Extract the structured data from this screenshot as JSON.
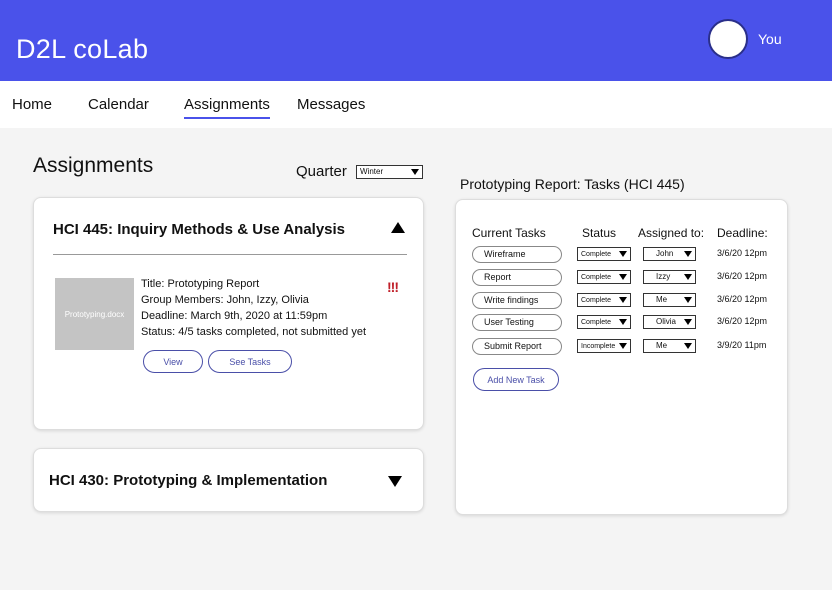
{
  "app": {
    "title": "D2L coLab",
    "user_name": "You"
  },
  "nav": {
    "home": "Home",
    "calendar": "Calendar",
    "assignments": "Assignments",
    "messages": "Messages"
  },
  "main": {
    "title": "Assignments",
    "quarter_label": "Quarter",
    "quarter_value": "Winter"
  },
  "courses": [
    {
      "title": "HCI 445: Inquiry Methods & Use Analysis",
      "expanded": true,
      "assignment": {
        "file_name": "Prototyping.docx",
        "title": "Title: Prototyping Report",
        "members": "Group Members: John, Izzy, Olivia",
        "deadline": "Deadline: March 9th, 2020 at 11:59pm",
        "status": "Status: 4/5 tasks completed, not submitted yet",
        "priority": "!!!",
        "view_label": "View",
        "see_tasks_label": "See Tasks"
      }
    },
    {
      "title": "HCI 430: Prototyping & Implementation",
      "expanded": false
    }
  ],
  "tasks_panel": {
    "heading": "Prototyping Report: Tasks (HCI 445)",
    "columns": {
      "task": "Current Tasks",
      "status": "Status",
      "assigned": "Assigned to:",
      "deadline": "Deadline:"
    },
    "tasks": [
      {
        "name": "Wireframe",
        "status": "Complete",
        "assignee": "John",
        "deadline": "3/6/20 12pm"
      },
      {
        "name": "Report",
        "status": "Complete",
        "assignee": "Izzy",
        "deadline": "3/6/20 12pm"
      },
      {
        "name": "Write findings",
        "status": "Complete",
        "assignee": "Me",
        "deadline": "3/6/20 12pm"
      },
      {
        "name": "User Testing",
        "status": "Complete",
        "assignee": "Olivia",
        "deadline": "3/6/20 12pm"
      },
      {
        "name": "Submit Report",
        "status": "Incomplete",
        "assignee": "Me",
        "deadline": "3/9/20 11pm"
      }
    ],
    "add_label": "Add New Task"
  },
  "colors": {
    "accent": "#4a52ea",
    "priority": "#c0202a",
    "thumbnail": "#c4c4c4"
  }
}
